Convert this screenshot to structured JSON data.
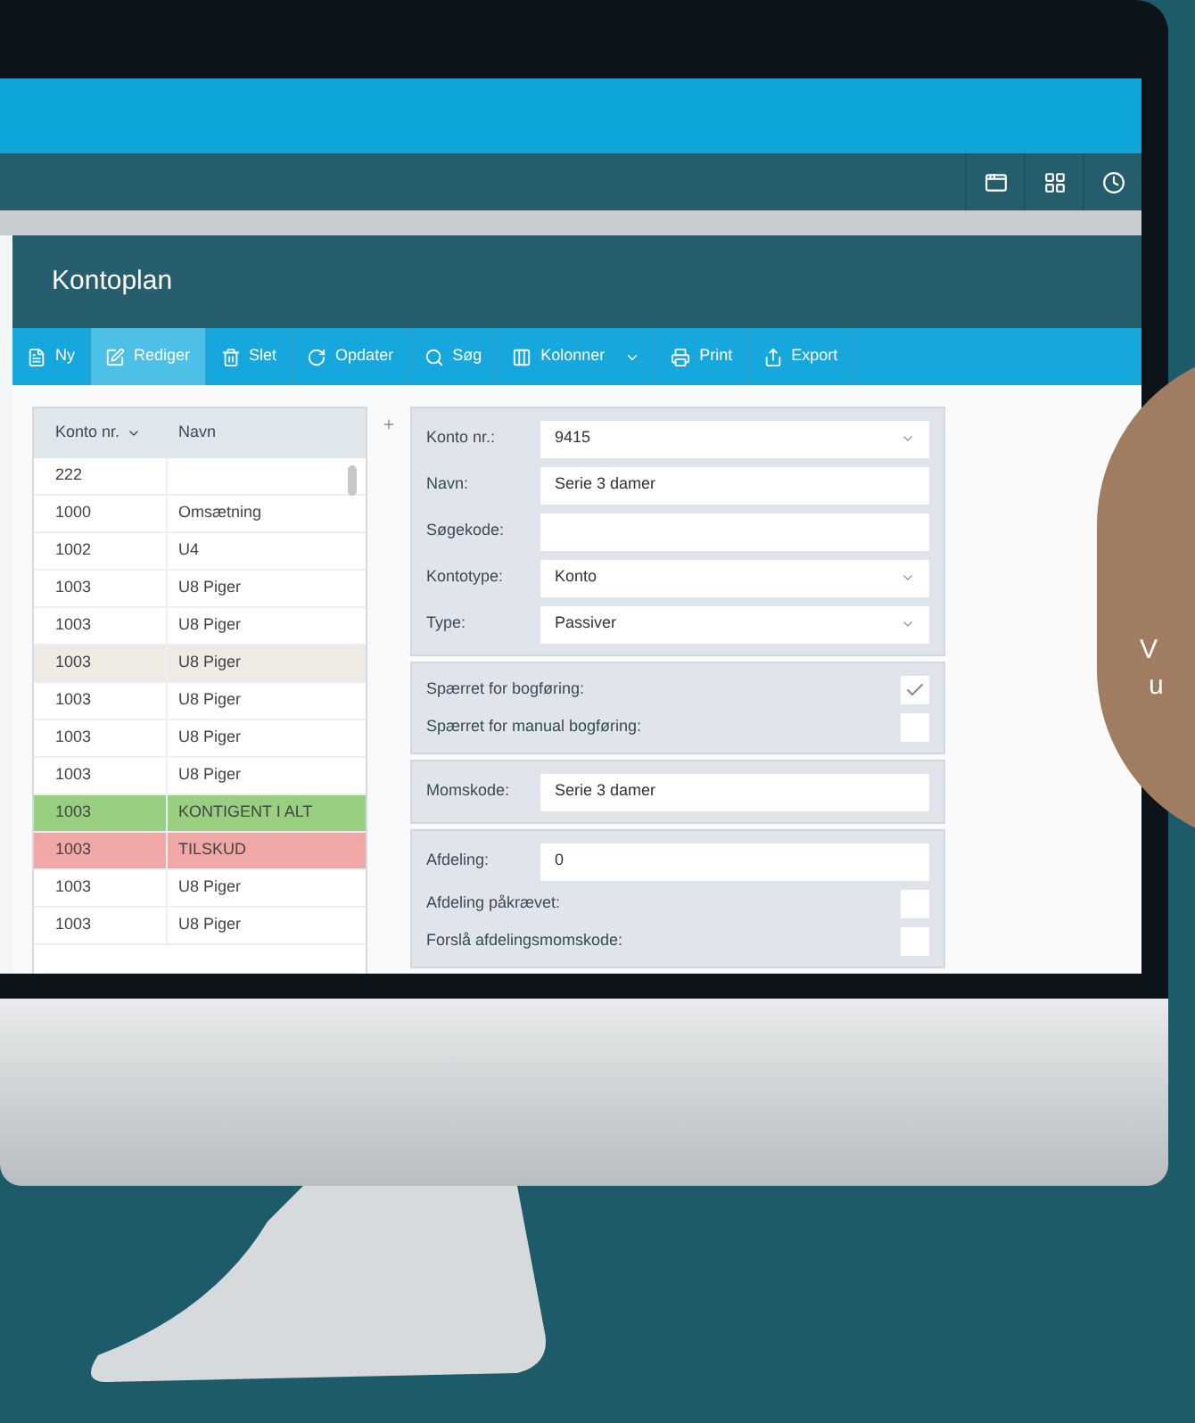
{
  "page_title": "Kontoplan",
  "toolbar": [
    {
      "label": "Ny",
      "selected": false,
      "dropdown": false
    },
    {
      "label": "Rediger",
      "selected": true,
      "dropdown": false
    },
    {
      "label": "Slet",
      "selected": false,
      "dropdown": false
    },
    {
      "label": "Opdater",
      "selected": false,
      "dropdown": false
    },
    {
      "label": "Søg",
      "selected": false,
      "dropdown": false
    },
    {
      "label": "Kolonner",
      "selected": false,
      "dropdown": true
    },
    {
      "label": "Print",
      "selected": false,
      "dropdown": false
    },
    {
      "label": "Export",
      "selected": false,
      "dropdown": false
    }
  ],
  "table": {
    "columns": [
      "Konto nr.",
      "Navn"
    ],
    "rows": [
      {
        "cells": [
          "222",
          ""
        ],
        "color": "#ffffff"
      },
      {
        "cells": [
          "1000",
          "Omsætning"
        ],
        "color": "#ffffff"
      },
      {
        "cells": [
          "1002",
          "U4"
        ],
        "color": "#ffffff"
      },
      {
        "cells": [
          "1003",
          "U8 Piger"
        ],
        "color": "#ffffff"
      },
      {
        "cells": [
          "1003",
          "U8 Piger"
        ],
        "color": "#ffffff"
      },
      {
        "cells": [
          "1003",
          "U8 Piger"
        ],
        "color": "#efebe4"
      },
      {
        "cells": [
          "1003",
          "U8 Piger"
        ],
        "color": "#ffffff"
      },
      {
        "cells": [
          "1003",
          "U8 Piger"
        ],
        "color": "#ffffff"
      },
      {
        "cells": [
          "1003",
          "U8 Piger"
        ],
        "color": "#ffffff"
      },
      {
        "cells": [
          "1003",
          "KONTIGENT I ALT"
        ],
        "color": "#98cf80"
      },
      {
        "cells": [
          "1003",
          "TILSKUD"
        ],
        "color": "#f2a7a7"
      },
      {
        "cells": [
          "1003",
          "U8 Piger"
        ],
        "color": "#ffffff"
      },
      {
        "cells": [
          "1003",
          "U8 Piger"
        ],
        "color": "#ffffff"
      }
    ]
  },
  "form": {
    "sections": [
      {
        "rows": [
          {
            "kind": "select",
            "label": "Konto nr.:",
            "value": "9415"
          },
          {
            "kind": "text",
            "label": "Navn:",
            "value": "Serie 3 damer"
          },
          {
            "kind": "text",
            "label": "Søgekode:"
          },
          {
            "kind": "select",
            "label": "Kontotype:",
            "value": "Konto"
          },
          {
            "kind": "select",
            "label": "Type:",
            "value": "Passiver"
          }
        ]
      },
      {
        "rows": [
          {
            "kind": "checkbox",
            "label": "Spærret for bogføring:",
            "checked": true
          },
          {
            "kind": "checkbox",
            "label": "Spærret for manual bogføring:",
            "checked": false
          }
        ]
      },
      {
        "rows": [
          {
            "kind": "text",
            "label": "Momskode:",
            "value": "Serie 3 damer"
          }
        ]
      },
      {
        "rows": [
          {
            "kind": "text",
            "label": "Afdeling:",
            "value": "0"
          },
          {
            "kind": "checkbox",
            "label": "Afdeling påkrævet:",
            "checked": false
          },
          {
            "kind": "checkbox",
            "label": "Forslå afdelingsmomskode:",
            "checked": false
          }
        ]
      }
    ]
  },
  "badge": {
    "lines": [
      "V",
      "u"
    ]
  }
}
